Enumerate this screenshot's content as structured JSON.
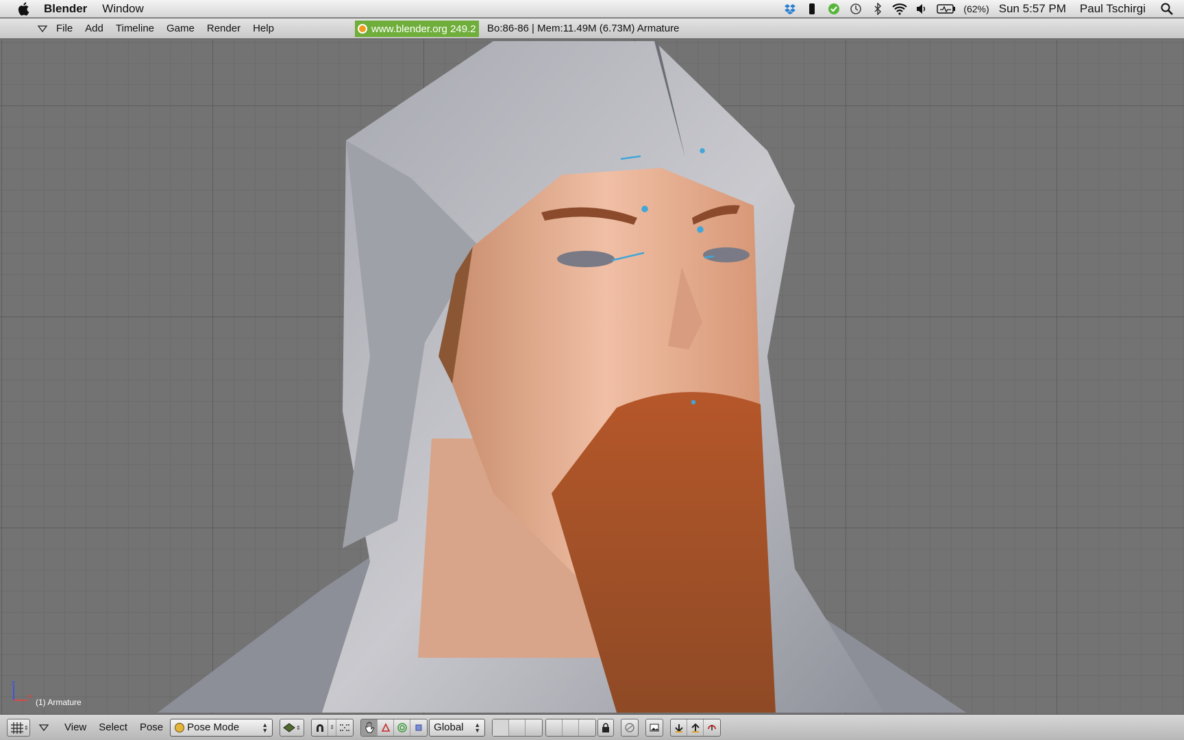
{
  "menubar": {
    "app_name": "Blender",
    "menus": [
      "Window"
    ],
    "battery": "(62%)",
    "clock": "Sun 5:57 PM",
    "user": "Paul Tschirgi",
    "status_icons": [
      "dropbox-icon",
      "phone-icon",
      "check-shield-icon",
      "time-machine-icon",
      "bluetooth-icon",
      "wifi-icon",
      "volume-icon",
      "battery-icon"
    ]
  },
  "info_header": {
    "menus": [
      "File",
      "Add",
      "Timeline",
      "Game",
      "Render",
      "Help"
    ],
    "brand": "www.blender.org 249.2",
    "stats": "Bo:86-86   | Mem:11.49M (6.73M) Armature"
  },
  "viewport": {
    "object_label": "(1) Armature",
    "axis_labels": {
      "z": "z",
      "x": "x"
    },
    "bone_color": "#41a6d8"
  },
  "view_header": {
    "menus": [
      "View",
      "Select",
      "Pose"
    ],
    "mode": "Pose Mode",
    "orientation": "Global"
  },
  "colors": {
    "menubar": "#dedede",
    "header": "#c9c9c9",
    "viewport_bg": "#737373",
    "brand_green": "#6fae3a"
  }
}
